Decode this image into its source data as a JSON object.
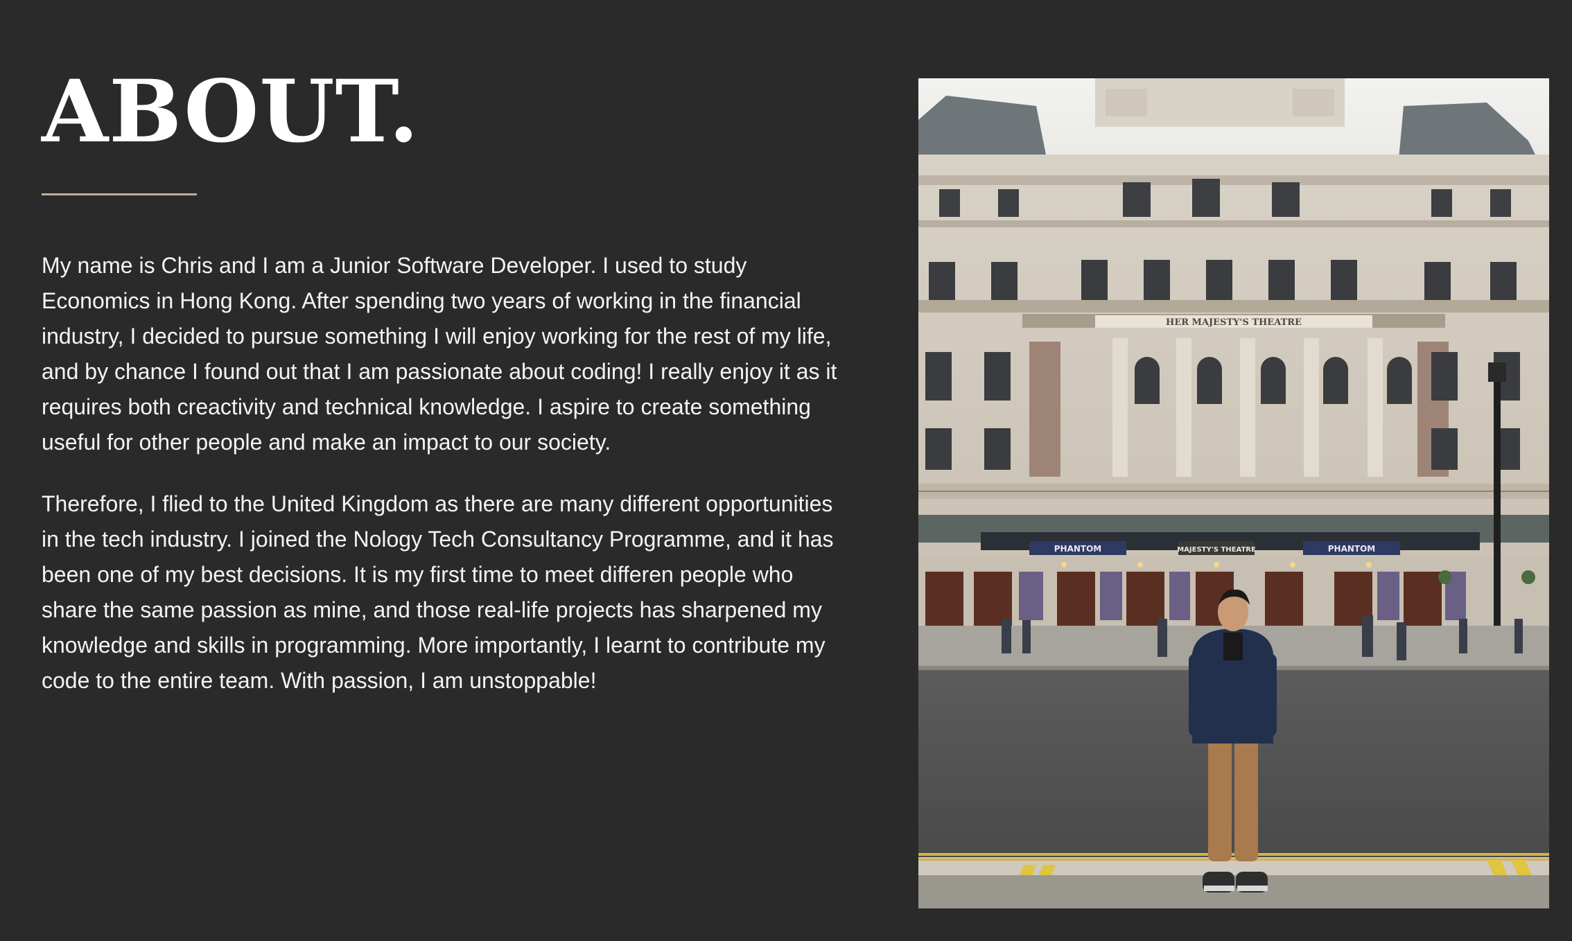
{
  "about": {
    "title": "ABOUT.",
    "paragraphs": [
      "My name is Chris and I am a Junior Software Developer. I used to study Economics in Hong Kong. After spending two years of working in the financial industry, I decided to pursue something I will enjoy working for the rest of my life, and by chance I found out that I am passionate about coding! I really enjoy it as it requires both creactivity and technical knowledge. I aspire to create something useful for other people and make an impact to our society.",
      "Therefore, I flied to the United Kingdom as there are many different opportunities in the tech industry. I joined the Nology Tech Consultancy Programme, and it has been one of my best decisions. It is my first time to meet differen people who share the same passion as mine, and those real-life projects has sharpened my knowledge and skills in programming. More importantly, I learnt to contribute my code to the entire team. With passion, I am unstoppable!"
    ]
  },
  "photo": {
    "theatre_sign": "HER MAJESTY'S THEATRE",
    "banners": [
      "PHANTOM",
      "MAJESTY'S THEATRE",
      "PHANTOM"
    ]
  },
  "colors": {
    "background": "#2a2a2a",
    "accent_underline": "#c7ae92",
    "text": "#ffffff"
  }
}
